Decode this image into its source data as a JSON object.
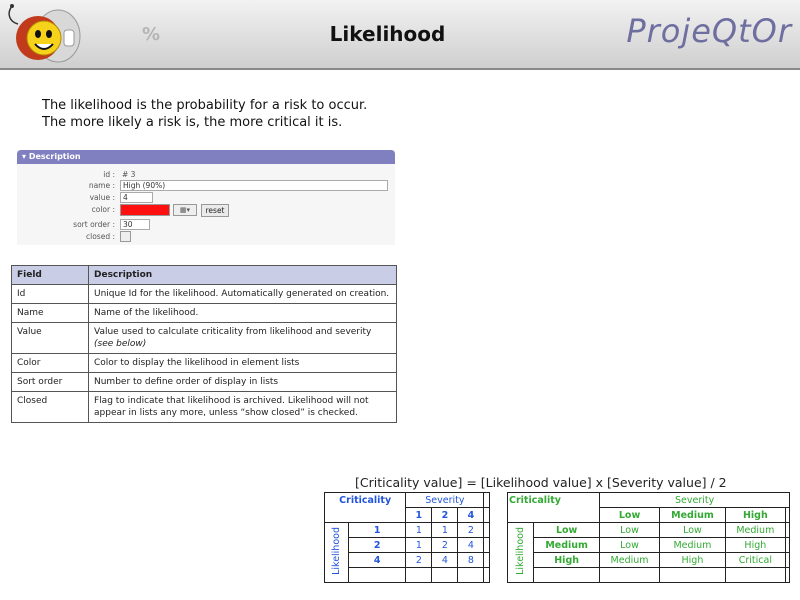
{
  "header": {
    "title": "Likelihood",
    "brand": "ProjeQtOr",
    "percent_glyph": "%"
  },
  "intro": {
    "line1": "The likelihood is the probability for a risk to occur.",
    "line2": "The more likely a risk is, the more critical it is."
  },
  "form": {
    "section_title": "Description",
    "fields": [
      {
        "label": "id :",
        "value": "# 3"
      },
      {
        "label": "name :",
        "value": "High (90%)"
      },
      {
        "label": "value :",
        "value": "4"
      },
      {
        "label": "color :",
        "value": ""
      },
      {
        "label": "sort order :",
        "value": "30"
      },
      {
        "label": "closed :",
        "value": ""
      }
    ],
    "reset_label": "reset",
    "color_value": "#ff1010"
  },
  "field_table": {
    "headers": [
      "Field",
      "Description"
    ],
    "rows": [
      {
        "field": "Id",
        "desc": "Unique Id for the likelihood. Automatically generated on creation."
      },
      {
        "field": "Name",
        "desc": "Name of the likelihood."
      },
      {
        "field": "Value",
        "desc": "Value used to calculate criticality from likelihood and severity",
        "note": "(see below)"
      },
      {
        "field": "Color",
        "desc": "Color to display the likelihood in element lists"
      },
      {
        "field": "Sort order",
        "desc": "Number to define order of display in lists"
      },
      {
        "field": "Closed",
        "desc": "Flag to indicate that likelihood is archived. Likelihood will not appear in lists any more, unless “show closed” is checked."
      }
    ]
  },
  "formula": "[Criticality value] = [Likelihood value] x [Severity value] / 2",
  "matrix_values": {
    "criticality": "Criticality",
    "severity": "Severity",
    "likelihood": "Likelihood",
    "cols": [
      "1",
      "2",
      "4"
    ],
    "rows": [
      {
        "head": "1",
        "cells": [
          "1",
          "1",
          "2"
        ]
      },
      {
        "head": "2",
        "cells": [
          "1",
          "2",
          "4"
        ]
      },
      {
        "head": "4",
        "cells": [
          "2",
          "4",
          "8"
        ]
      }
    ]
  },
  "matrix_names": {
    "criticality": "Criticality",
    "severity": "Severity",
    "likelihood": "Likelihood",
    "cols": [
      "Low",
      "Medium",
      "High"
    ],
    "rows": [
      {
        "head": "Low",
        "cells": [
          "Low",
          "Low",
          "Medium"
        ]
      },
      {
        "head": "Medium",
        "cells": [
          "Low",
          "Medium",
          "High"
        ]
      },
      {
        "head": "High",
        "cells": [
          "Medium",
          "High",
          "Critical"
        ]
      }
    ]
  },
  "colors": {
    "blue_matrix": "#2255dd",
    "green_matrix": "#33aa33",
    "section_bar": "#8080c0"
  }
}
